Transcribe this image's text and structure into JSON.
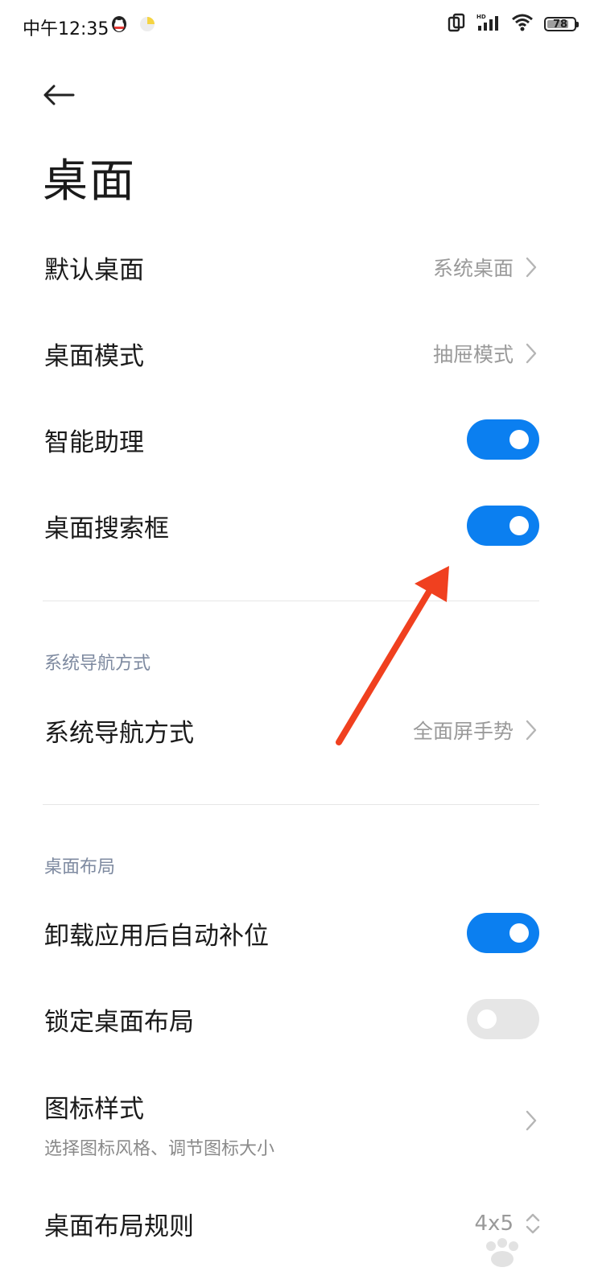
{
  "status_bar": {
    "time": "中午12:35",
    "battery": "78"
  },
  "header": {
    "title": "桌面"
  },
  "items": {
    "default_desktop": {
      "label": "默认桌面",
      "value": "系统桌面"
    },
    "desktop_mode": {
      "label": "桌面模式",
      "value": "抽屉模式"
    },
    "smart_assistant": {
      "label": "智能助理",
      "enabled": true
    },
    "desktop_search": {
      "label": "桌面搜索框",
      "enabled": true
    }
  },
  "nav_section": {
    "header": "系统导航方式",
    "item": {
      "label": "系统导航方式",
      "value": "全面屏手势"
    }
  },
  "layout_section": {
    "header": "桌面布局",
    "auto_fill": {
      "label": "卸载应用后自动补位",
      "enabled": true
    },
    "lock_layout": {
      "label": "锁定桌面布局",
      "enabled": false
    },
    "icon_style": {
      "label": "图标样式",
      "subtitle": "选择图标风格、调节图标大小"
    },
    "layout_rule": {
      "label": "桌面布局规则",
      "value": "4x5"
    }
  },
  "colors": {
    "accent": "#0b7ff0",
    "annotation_arrow": "#f0401f"
  }
}
